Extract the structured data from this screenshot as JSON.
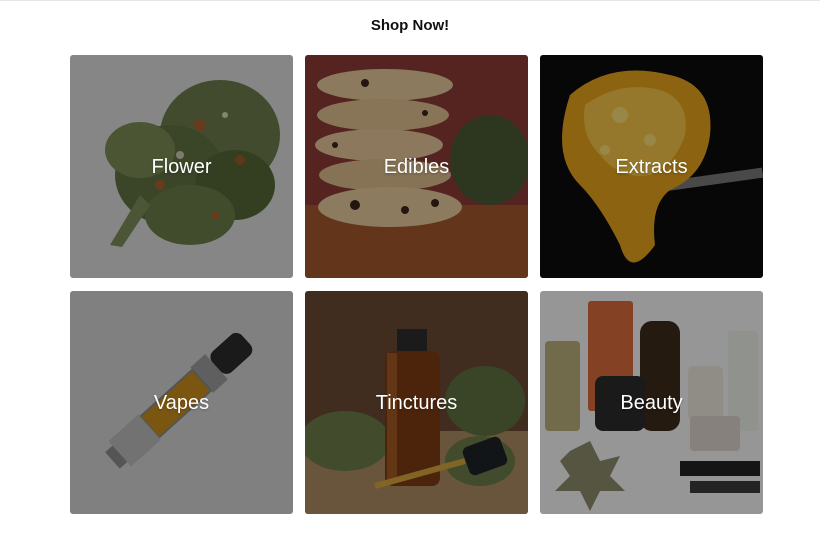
{
  "page": {
    "heading": "Shop Now!"
  },
  "categories": [
    {
      "label": "Flower"
    },
    {
      "label": "Edibles"
    },
    {
      "label": "Extracts"
    },
    {
      "label": "Vapes"
    },
    {
      "label": "Tinctures"
    },
    {
      "label": "Beauty"
    }
  ]
}
